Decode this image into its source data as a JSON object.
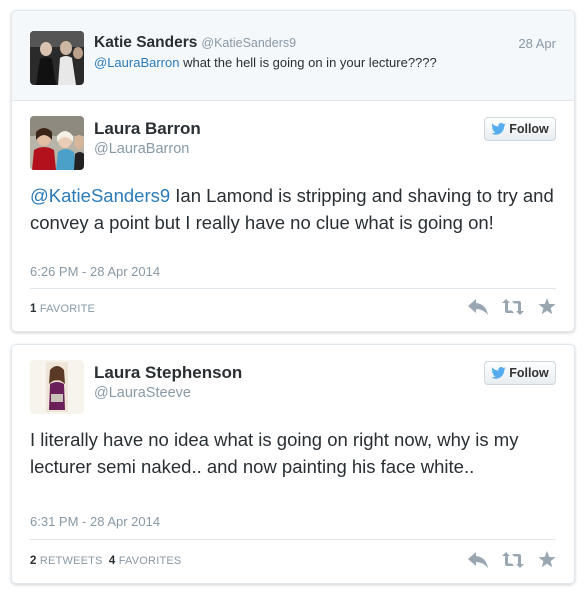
{
  "tweets": [
    {
      "in_reply_to": {
        "name": "Katie Sanders",
        "handle": "@KatieSanders9",
        "date": "28 Apr",
        "mention": "@LauraBarron",
        "text": " what the hell is going on in your lecture????"
      },
      "author": {
        "name": "Laura Barron",
        "handle": "@LauraBarron"
      },
      "follow_label": "Follow",
      "mention": "@KatieSanders9",
      "text": " Ian Lamond is stripping and shaving to try and convey a point but I really have no clue what is going on!",
      "timestamp": "6:26 PM - 28 Apr 2014",
      "stats": {
        "favorites_count": "1",
        "favorites_label": "FAVORITE"
      }
    },
    {
      "author": {
        "name": "Laura Stephenson",
        "handle": "@LauraSteeve"
      },
      "follow_label": "Follow",
      "text": "I literally have no idea what is going on right now, why is my lecturer semi naked.. and now painting his face white..",
      "timestamp": "6:31 PM - 28 Apr 2014",
      "stats": {
        "retweets_count": "2",
        "retweets_label": "RETWEETS",
        "favorites_count": "4",
        "favorites_label": "FAVORITES"
      }
    }
  ],
  "colors": {
    "link": "#2b7bb9",
    "twitter_bird": "#55acee",
    "muted": "#8899a6",
    "action_icon": "#9aa7b3"
  },
  "icons": [
    "twitter-bird-icon",
    "reply-icon",
    "retweet-icon",
    "favorite-star-icon"
  ]
}
